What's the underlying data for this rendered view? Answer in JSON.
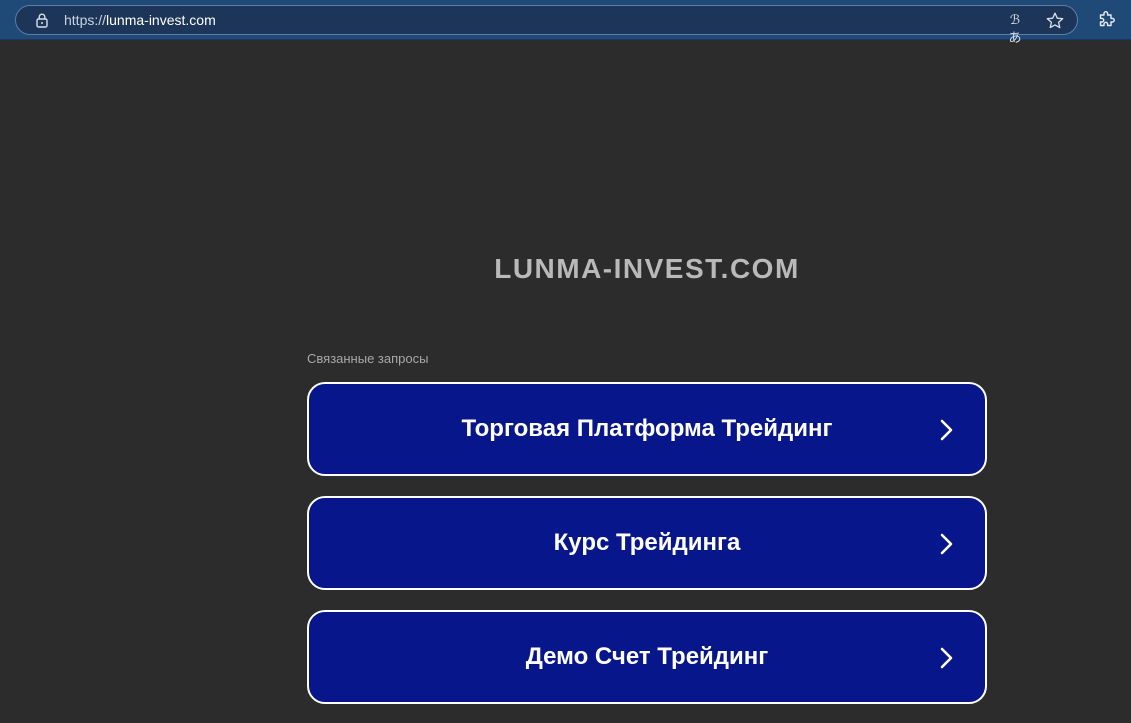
{
  "browser": {
    "url_scheme": "https://",
    "url_host": "lunma-invest.com",
    "translate_icon": "translate-icon",
    "bookmark_icon": "star-icon",
    "extensions_icon": "puzzle-icon"
  },
  "page": {
    "site_title": "LUNMA-INVEST.COM",
    "related_label": "Связанные запросы",
    "results": [
      {
        "label": "Торговая Платформа Трейдинг"
      },
      {
        "label": "Курс Трейдинга"
      },
      {
        "label": "Демо Счет Трейдинг"
      }
    ]
  },
  "colors": {
    "background": "#2c2c2c",
    "toolbar": "#1f4a78",
    "button_fill": "#07168a",
    "button_border": "#ffffff",
    "title_text": "#b9b9b9"
  }
}
